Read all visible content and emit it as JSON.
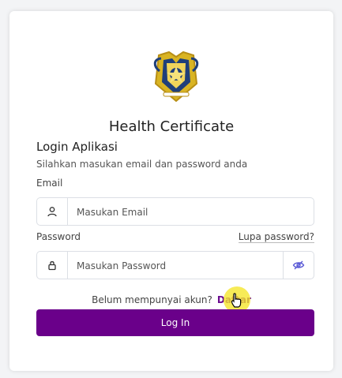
{
  "app": {
    "title": "Health Certificate"
  },
  "login": {
    "heading": "Login Aplikasi",
    "subtitle": "Silahkan masukan email dan password anda",
    "email_label": "Email",
    "email_placeholder": "Masukan Email",
    "password_label": "Password",
    "forgot_password": "Lupa password?",
    "password_placeholder": "Masukan Password",
    "no_account_text": "Belum mempunyai akun?",
    "register_link": "Daftar",
    "login_button": "Log In"
  },
  "icons": {
    "email": "user-icon",
    "password": "lock-icon",
    "toggle": "eye-off-icon",
    "logo": "emblem-logo",
    "cursor": "hand-cursor-icon"
  },
  "colors": {
    "brand": "#6a008a",
    "link": "#6a0b8f",
    "logo_gold": "#d9b423",
    "logo_navy": "#1f3f7a",
    "eye_icon": "#5b5bd6",
    "cursor_highlight": "#f5e628"
  }
}
